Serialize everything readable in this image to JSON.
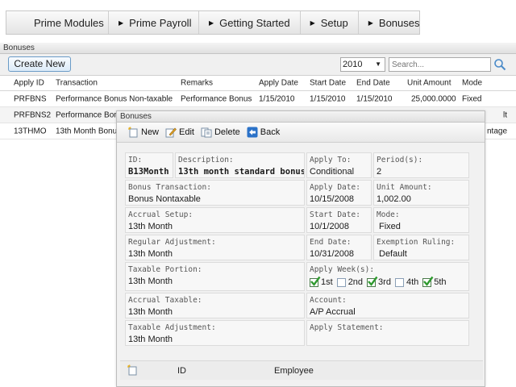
{
  "nav": {
    "items": [
      "Prime Modules",
      "Prime Payroll",
      "Getting Started",
      "Setup",
      "Bonuses"
    ]
  },
  "grid": {
    "title": "Bonuses",
    "create_label": "Create New",
    "year": "2010",
    "search_placeholder": "Search...",
    "columns": [
      "Apply ID",
      "Transaction",
      "Remarks",
      "Apply Date",
      "Start Date",
      "End Date",
      "Unit Amount",
      "Mode"
    ],
    "rows": [
      {
        "id": "PRFBNS",
        "transaction": "Performance Bonus Non-taxable",
        "remarks": "Performance Bonus",
        "apply_date": "1/15/2010",
        "start_date": "1/15/2010",
        "end_date": "1/15/2010",
        "unit_amount": "25,000.0000",
        "mode": "Fixed"
      },
      {
        "id": "PRFBNS2",
        "transaction": "Performance Bon",
        "remarks": "",
        "apply_date": "",
        "start_date": "",
        "end_date": "",
        "unit_amount": "",
        "mode": "lt"
      },
      {
        "id": "13THMO",
        "transaction": "13th Month Bonu",
        "remarks": "",
        "apply_date": "",
        "start_date": "",
        "end_date": "",
        "unit_amount": "",
        "mode": "ntage"
      }
    ]
  },
  "dialog": {
    "title": "Bonuses",
    "toolbar": {
      "new": "New",
      "edit": "Edit",
      "delete": "Delete",
      "back": "Back"
    },
    "fields": {
      "id_label": "ID:",
      "id_value": "B13Month",
      "desc_label": "Description:",
      "desc_value": "13th month standard bonus",
      "apply_to_label": "Apply To:",
      "apply_to_value": "Conditional",
      "period_label": "Period(s):",
      "period_value": "2",
      "bonus_tx_label": "Bonus Transaction:",
      "bonus_tx_value": "Bonus Nontaxable",
      "apply_date_label": "Apply Date:",
      "apply_date_value": "10/15/2008",
      "unit_amount_label": "Unit Amount:",
      "unit_amount_value": "1,002.00",
      "accrual_setup_label": "Accrual Setup:",
      "accrual_setup_value": "13th Month",
      "start_date_label": "Start Date:",
      "start_date_value": "10/1/2008",
      "mode_label": "Mode:",
      "mode_value": "Fixed",
      "regular_adj_label": "Regular Adjustment:",
      "regular_adj_value": "13th Month",
      "end_date_label": "End Date:",
      "end_date_value": "10/31/2008",
      "exemption_label": "Exemption Ruling:",
      "exemption_value": "Default",
      "taxable_portion_label": "Taxable Portion:",
      "taxable_portion_value": "13th Month",
      "apply_week_label": "Apply Week(s):",
      "accrual_taxable_label": "Accrual Taxable:",
      "accrual_taxable_value": "13th Month",
      "account_label": "Account:",
      "account_value": "A/P Accrual",
      "taxable_adj_label": "Taxable Adjustment:",
      "taxable_adj_value": "13th Month",
      "apply_statement_label": "Apply Statement:"
    },
    "weeks": [
      {
        "label": "1st",
        "checked": true
      },
      {
        "label": "2nd",
        "checked": false
      },
      {
        "label": "3rd",
        "checked": true
      },
      {
        "label": "4th",
        "checked": false
      },
      {
        "label": "5th",
        "checked": true
      }
    ],
    "footer": {
      "col_id": "ID",
      "col_employee": "Employee"
    }
  }
}
